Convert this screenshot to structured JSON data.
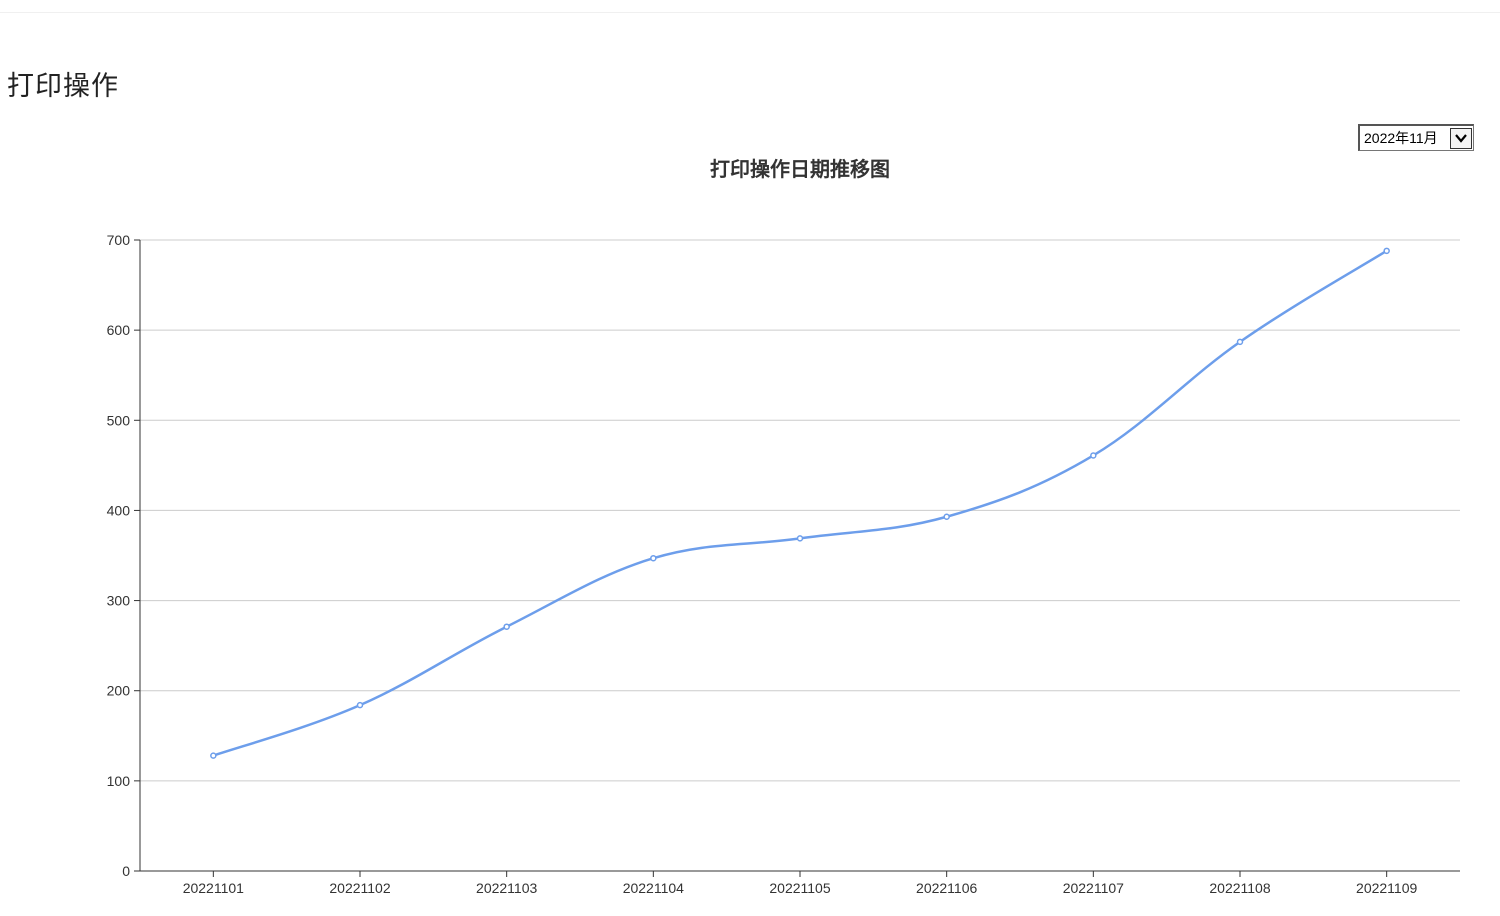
{
  "page": {
    "title": "打印操作"
  },
  "month_selector": {
    "selected": "2022年11月"
  },
  "colors": {
    "line": "#6d9eeb",
    "grid": "#cccccc",
    "axis": "#333333",
    "text": "#333333"
  },
  "chart_data": {
    "type": "line",
    "title": "打印操作日期推移图",
    "xlabel": "",
    "ylabel": "",
    "categories": [
      "20221101",
      "20221102",
      "20221103",
      "20221104",
      "20221105",
      "20221106",
      "20221107",
      "20221108",
      "20221109"
    ],
    "series": [
      {
        "values": [
          128,
          184,
          271,
          347,
          369,
          393,
          461,
          587,
          688
        ]
      }
    ],
    "ylim": [
      0,
      700
    ],
    "yticks": [
      0,
      100,
      200,
      300,
      400,
      500,
      600,
      700
    ],
    "grid": true,
    "smooth": true,
    "markers": "hollow-circle"
  }
}
